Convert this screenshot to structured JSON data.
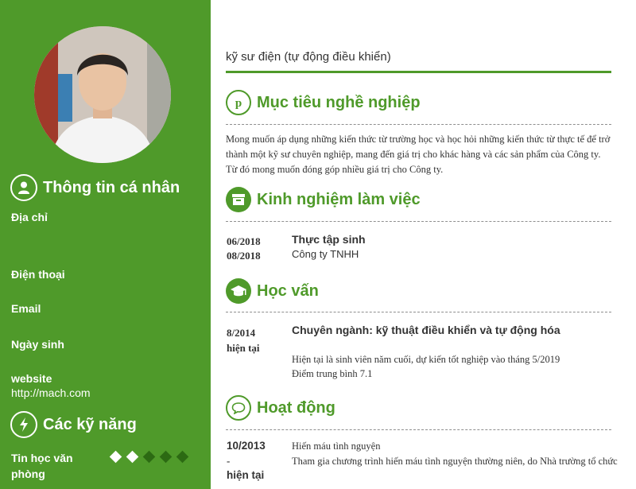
{
  "sidebar": {
    "personal_title": "Thông tin cá nhân",
    "address_label": "Địa chỉ",
    "phone_label": "Điện thoại",
    "email_label": "Email",
    "birthday_label": "Ngày sinh",
    "website_label": "website",
    "website_value": "http://mach.com",
    "skills_title": "Các kỹ năng",
    "skill_name": "Tin học văn phòng",
    "skill_level": 2,
    "skill_max": 5
  },
  "main": {
    "job_title": "kỹ sư điện (tự động điều khiển)",
    "objective_title": "Mục tiêu nghề nghiệp",
    "objective_text": "Mong muốn áp dụng những kiến thức từ trường học và học hỏi những kiến thức từ thực tế để trở thành một kỹ sư chuyên nghiệp, mang đến giá trị cho khác hàng và các sản phẩm của Công ty. Từ đó mong muốn đóng góp nhiều giá trị cho Công ty.",
    "experience_title": "Kinh nghiệm làm việc",
    "experience": {
      "start": "06/2018",
      "end": "08/2018",
      "position": "Thực tập sinh",
      "company": "Công ty TNHH"
    },
    "education_title": "Học vấn",
    "education": {
      "start": "8/2014",
      "end": "hiện tại",
      "major": "Chuyên ngành: kỹ thuật điều khiển và tự động hóa",
      "note1": "Hiện tại là sinh viên năm cuối, dự kiến tốt nghiệp vào tháng 5/2019",
      "note2": "Điểm trung bình 7.1"
    },
    "activities_title": "Hoạt động",
    "activity": {
      "start": "10/2013",
      "dash": "-",
      "end": "hiện tại",
      "name": "Hiến máu tình nguyện",
      "desc": "Tham gia chương trình hiến máu tình nguyện thường niên, do Nhà trường tổ chức"
    }
  },
  "colors": {
    "accent": "#4f9a2a",
    "dark_green": "#2c6a13"
  }
}
